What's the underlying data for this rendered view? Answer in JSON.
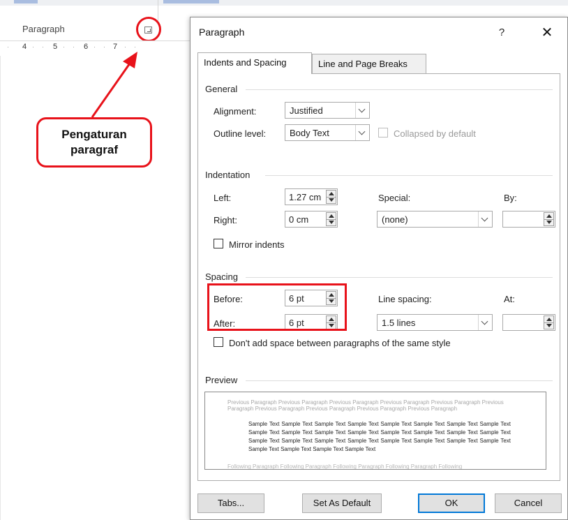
{
  "ribbon": {
    "group_label": "Paragraph",
    "ruler_numbers": [
      "4",
      "5",
      "6",
      "7"
    ]
  },
  "annotation": {
    "callout_text": "Pengaturan\nparagraf",
    "accent_color": "#e8121a"
  },
  "dialog": {
    "title": "Paragraph",
    "help_label": "?",
    "close_label": "✕",
    "tabs": [
      {
        "label": "Indents and Spacing",
        "active": true
      },
      {
        "label": "Line and Page Breaks",
        "active": false
      }
    ],
    "general": {
      "heading": "General",
      "alignment_label": "Alignment:",
      "alignment_value": "Justified",
      "outline_label": "Outline level:",
      "outline_value": "Body Text",
      "collapsed_label": "Collapsed by default"
    },
    "indentation": {
      "heading": "Indentation",
      "left_label": "Left:",
      "left_value": "1.27 cm",
      "right_label": "Right:",
      "right_value": "0 cm",
      "special_label": "Special:",
      "special_value": "(none)",
      "by_label": "By:",
      "by_value": "",
      "mirror_label": "Mirror indents"
    },
    "spacing": {
      "heading": "Spacing",
      "before_label": "Before:",
      "before_value": "6 pt",
      "after_label": "After:",
      "after_value": "6 pt",
      "line_spacing_label": "Line spacing:",
      "line_spacing_value": "1.5 lines",
      "at_label": "At:",
      "at_value": "",
      "dont_add_label": "Don't add space between paragraphs of the same style"
    },
    "preview": {
      "heading": "Preview",
      "previous_text": "Previous Paragraph Previous Paragraph Previous Paragraph Previous Paragraph Previous Paragraph Previous Paragraph Previous Paragraph Previous Paragraph Previous Paragraph Previous Paragraph",
      "sample_text": "Sample Text Sample Text Sample Text Sample Text Sample Text Sample Text Sample Text Sample Text Sample Text Sample Text Sample Text Sample Text Sample Text Sample Text Sample Text Sample Text Sample Text Sample Text Sample Text Sample Text Sample Text Sample Text Sample Text Sample Text Sample Text Sample Text Sample Text Sample Text",
      "following_text": "Following Paragraph Following Paragraph Following Paragraph Following Paragraph Following"
    },
    "buttons": {
      "tabs": "Tabs...",
      "set_default": "Set As Default",
      "ok": "OK",
      "cancel": "Cancel"
    }
  }
}
